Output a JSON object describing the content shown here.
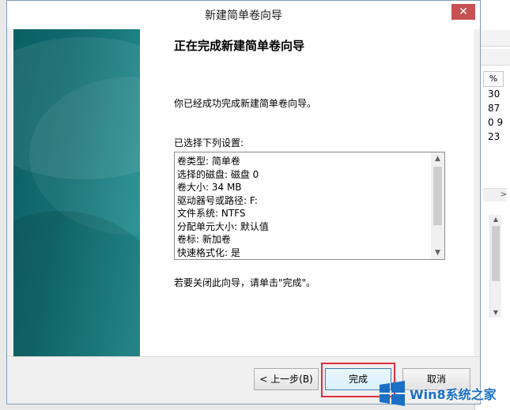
{
  "dialog": {
    "title": "新建简单卷向导",
    "close_symbol": "✕",
    "heading": "正在完成新建简单卷向导",
    "success_text": "你已经成功完成新建简单卷向导。",
    "selected_text": "已选择下列设置:",
    "summary_lines": [
      "卷类型: 简单卷",
      "选择的磁盘: 磁盘 0",
      "卷大小: 34 MB",
      "驱动器号或路径: F:",
      "文件系统: NTFS",
      "分配单元大小: 默认值",
      "卷标: 新加卷",
      "快速格式化: 是"
    ],
    "close_text": "若要关闭此向导，请单击\"完成\"。",
    "buttons": {
      "back": "< 上一步(B)",
      "finish": "完成",
      "cancel": "取消"
    }
  },
  "background_window": {
    "column_header": "%",
    "cells": [
      "30",
      "87",
      "0 9",
      "23"
    ]
  },
  "watermark": {
    "text": "Win8系统之家"
  },
  "colors": {
    "sidebar": "#136d70",
    "highlight": "#e0303b",
    "close_button": "#c75050",
    "watermark": "#1b6fc4"
  }
}
